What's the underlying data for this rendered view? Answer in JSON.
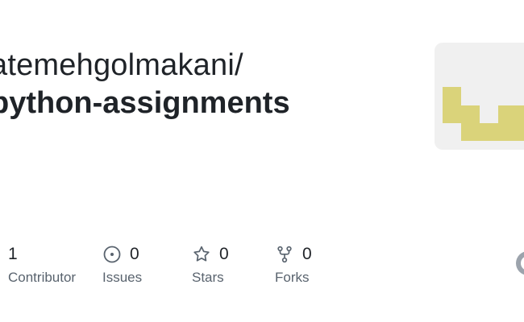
{
  "repo": {
    "owner_slash": "atemehgolmakani/",
    "name": "python-assignments"
  },
  "avatar": {
    "pattern_color": "#dad37a",
    "background": "#f0f0f0"
  },
  "stats": [
    {
      "count": "1",
      "label": "Contributor",
      "icon": "people-icon"
    },
    {
      "count": "0",
      "label": "Issues",
      "icon": "issue-circle-icon"
    },
    {
      "count": "0",
      "label": "Stars",
      "icon": "star-icon"
    },
    {
      "count": "0",
      "label": "Forks",
      "icon": "fork-icon"
    }
  ],
  "colors": {
    "text": "#1f2328",
    "muted": "#59636e"
  }
}
